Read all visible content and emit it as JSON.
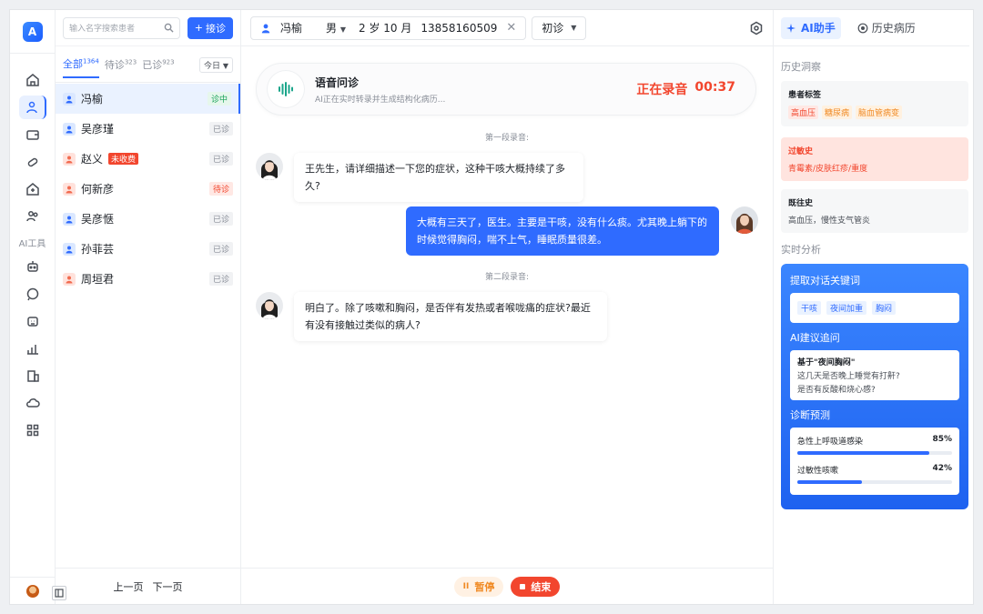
{
  "patients_panel": {
    "search_placeholder": "输入名字搜索患者",
    "admit_button": "接诊",
    "tabs": [
      {
        "label": "全部",
        "count": "1364"
      },
      {
        "label": "待诊",
        "count": "323"
      },
      {
        "label": "已诊",
        "count": "923"
      }
    ],
    "date_filter": "今日",
    "patients": [
      {
        "name": "冯榆",
        "gender": "male",
        "status": "诊中",
        "status_type": "active"
      },
      {
        "name": "吴彦瑾",
        "gender": "male",
        "status": "已诊",
        "status_type": "done"
      },
      {
        "name": "赵义",
        "gender": "female",
        "badge": "未收费",
        "status": "已诊",
        "status_type": "done"
      },
      {
        "name": "何新彦",
        "gender": "female",
        "status": "待诊",
        "status_type": "wait"
      },
      {
        "name": "吴彦惬",
        "gender": "male",
        "status": "已诊",
        "status_type": "done"
      },
      {
        "name": "孙菲芸",
        "gender": "male",
        "status": "已诊",
        "status_type": "done"
      },
      {
        "name": "周垣君",
        "gender": "female",
        "status": "已诊",
        "status_type": "done"
      }
    ],
    "prev_page": "上一页",
    "next_page": "下一页"
  },
  "rail": {
    "ai_tools_label": "AI工具"
  },
  "current_patient": {
    "name": "冯榆",
    "gender": "男",
    "age": "2 岁 10 月",
    "phone": "13858160509",
    "visit_type": "初诊"
  },
  "voice": {
    "title": "语音问诊",
    "subtitle": "AI正在实时转录并生成结构化病历...",
    "recording_label": "正在录音",
    "timer": "00:37"
  },
  "conversation": {
    "segment1": "第一段录音:",
    "segment2": "第二段录音:",
    "doctor_msg1": "王先生，请详细描述一下您的症状，这种干咳大概持续了多久?",
    "patient_msg1": "大概有三天了，医生。主要是干咳，没有什么痰。尤其晚上躺下的时候觉得胸闷，喘不上气，睡眠质量很差。",
    "doctor_msg2": "明白了。除了咳嗽和胸闷，是否伴有发热或者喉咙痛的症状?最近有没有接触过类似的病人?"
  },
  "controls": {
    "pause": "暂停",
    "stop": "结束"
  },
  "right_panel": {
    "tab_ai": "AI助手",
    "tab_history": "历史病历",
    "history_section": "历史洞察",
    "tags_title": "患者标签",
    "tags": [
      "高血压",
      "糖尿病",
      "脑血管病变"
    ],
    "allergy_title": "过敏史",
    "allergy_body": "青霉素/皮肤红疹/重度",
    "past_title": "既往史",
    "past_body": "高血压，慢性支气管炎",
    "realtime_section": "实时分析",
    "keywords_title": "提取对话关键词",
    "keywords": [
      "干咳",
      "夜间加重",
      "胸闷"
    ],
    "suggest_title": "AI建议追问",
    "suggest_basis": "基于\"夜间胸闷\"",
    "suggest_q1": "这几天是否晚上睡觉有打鼾?",
    "suggest_q2": "是否有反酸和烧心感?",
    "diag_title": "诊断预测",
    "diagnoses": [
      {
        "name": "急性上呼吸道感染",
        "percent_label": "85%",
        "percent": 85
      },
      {
        "name": "过敏性咳嗽",
        "percent_label": "42%",
        "percent": 42
      }
    ]
  },
  "colors": {
    "primary": "#2f6bff",
    "danger": "#f2462e",
    "success": "#1ba35a",
    "warning": "#f08a24"
  }
}
